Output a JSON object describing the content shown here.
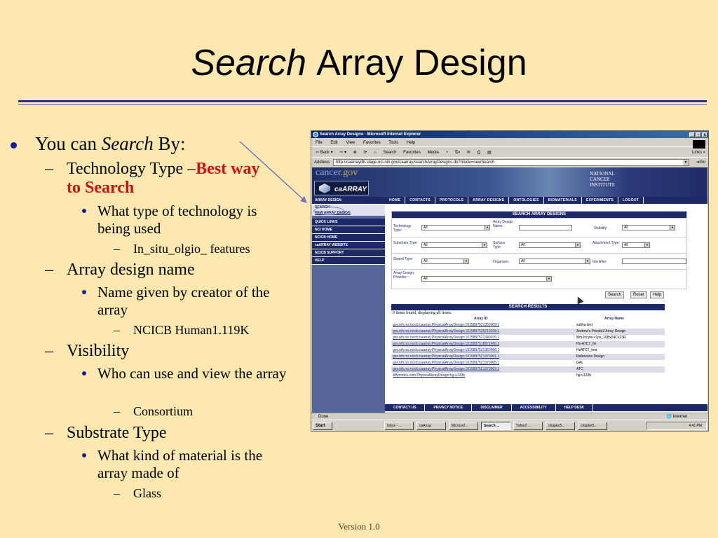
{
  "slide": {
    "title_italic": "Search",
    "title_rest": "Array Design",
    "version": "Version 1.0"
  },
  "bullets": {
    "l1": {
      "pre": "You can ",
      "italic": "Search",
      "post": " By:"
    },
    "tech": {
      "label": "Technology Type –",
      "emph": "Best way to Search",
      "sub": "What type of technology is being used",
      "ex": "In_situ_olgio_ features"
    },
    "name": {
      "label": "Array design name",
      "sub": "Name given by creator of the array",
      "ex": "NCICB Human1.119K"
    },
    "vis": {
      "label": "Visibility",
      "sub": "Who can use and view the array",
      "ex": "Consortium"
    },
    "substrate": {
      "label": "Substrate Type",
      "sub": "What kind of material is the array made of",
      "ex": "Glass"
    }
  },
  "browser": {
    "title": "Search Array Designs - Microsoft Internet Explorer",
    "menus": [
      "File",
      "Edit",
      "View",
      "Favorites",
      "Tools",
      "Help"
    ],
    "toolbar": [
      "⇦ Back ▾",
      "⇨ ▾",
      "⊗",
      "⟳",
      "⌂",
      "Search",
      "Favorites",
      "Media",
      "◔",
      "⎘▾",
      "✉",
      "⎙",
      "▤"
    ],
    "links": "Links »",
    "address_label": "Address",
    "url": "http://caarraydb-stage.nci.nih.gov/caarray/searchArrayDesigns.do?mode=newSearch",
    "go": "Go",
    "status": "Done",
    "zone": "Internet"
  },
  "site": {
    "cancer": "cancer",
    "gov": ".gov",
    "logo": "caARRAY",
    "nci": [
      "NATIONAL",
      "CANCER",
      "INSTITUTE"
    ],
    "nav": [
      "HOME",
      "CONTACTS",
      "PROTOCOLS",
      "ARRAY DESIGNS",
      "ONTOLOGIES",
      "BIOMATERIALS",
      "EXPERIMENTS",
      "LOGOUT"
    ],
    "left_head": "ARRAY DESIGN",
    "left_sub1": "SEARCH",
    "left_sub2": "NEW ARRAY DESIGN",
    "left_items": [
      "QUICK LINKS",
      "NCI HOME",
      "NCICB HOME",
      "caARRAY WEBSITE",
      "NCICB SUPPORT",
      "HELP"
    ],
    "footer": [
      "CONTACT US",
      "PRIVACY NOTICE",
      "DISCLAIMER",
      "ACCESSIBILITY",
      "HELP DESK"
    ]
  },
  "search": {
    "header": "SEARCH ARRAY DESIGNS",
    "tech_label": "Technology Type:",
    "tech_value": "All",
    "name_label": "Array Design Name:",
    "vis_label": "Visibility:",
    "vis_value": "All",
    "sub_label": "Substrate Type:",
    "sub_value": "All",
    "surface_label": "Surface Type:",
    "surface_value": "All",
    "attach_label": "Attachment Type:",
    "attach_value": "All",
    "strand_label": "Strand Type:",
    "strand_value": "All",
    "org_label": "Organism:",
    "org_value": "All",
    "ident_label": "Identifier:",
    "provider_label": "Array Design Provider:",
    "provider_value": "All",
    "btn_search": "Search",
    "btn_reset": "Reset",
    "btn_help": "Help"
  },
  "results": {
    "header": "SEARCH RESULTS",
    "count": "9 items found, displaying all items.",
    "col_id": "Array ID",
    "col_name": "Array Name",
    "rows": [
      {
        "id": "gov.nih.nci.ncicb.caarray:PhysicalArrayDesign:1015897521350009:1",
        "name": "subha test"
      },
      {
        "id": "gov.nih.nci.ncicb.caarray:PhysicalArrayDesign:1015897525219208:1",
        "name": "Andrew's Private2 Array Design"
      },
      {
        "id": "gov.nih.nci.ncicb.caarray:PhysicalArrayDesign:1015897521340076:1",
        "name": "Mm-Incyte-v1px_16Bx24Cx23R"
      },
      {
        "id": "gov.nih.nci.ncicb.caarray:PhysicalArrayDesign:1015897518972456:1",
        "name": "Hs-ATC7_6k"
      },
      {
        "id": "gov.nih.nci.ncicb.caarray:PhysicalArrayDesign:1015897521350006:1",
        "name": "HsATC7_test"
      },
      {
        "id": "gov.nih.nci.ncicb.caarray:PhysicalArrayDesign:1015897521370001:1",
        "name": "Reference Design"
      },
      {
        "id": "gov.nih.nci.ncicb.caarray:PhysicalArrayDesign:1015897521370005:1",
        "name": "GAL"
      },
      {
        "id": "gov.nih.nci.ncicb.caarray:PhysicalArrayDesign:1015897521370003:1",
        "name": "ATC"
      },
      {
        "id": "Affymetrix.com:PhysicalArrayDesign:hg-u133b",
        "name": "hg-u133b"
      }
    ]
  },
  "taskbar": {
    "start": "Start",
    "tasks": [
      "Inbox - ...",
      "caArray",
      "Microsof...",
      "Search ...",
      "Yahoo! ...",
      "chapter5...",
      "chapter5..."
    ],
    "clock": "4:41 PM"
  }
}
